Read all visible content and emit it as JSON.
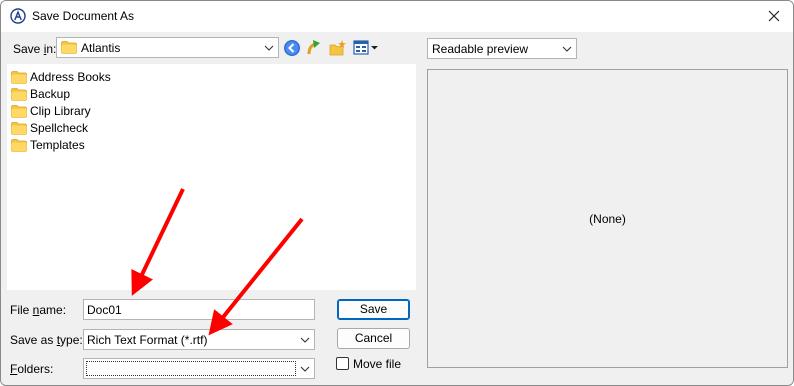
{
  "window": {
    "title": "Save Document As"
  },
  "location": {
    "label_pre": "Save ",
    "label_key": "i",
    "label_post": "n:",
    "current_folder": "Atlantis"
  },
  "folders_list": [
    {
      "name": "Address Books"
    },
    {
      "name": "Backup"
    },
    {
      "name": "Clip Library"
    },
    {
      "name": "Spellcheck"
    },
    {
      "name": "Templates"
    }
  ],
  "preview": {
    "mode": "Readable preview",
    "empty_text": "(None)"
  },
  "form": {
    "file_name_label_pre": "File ",
    "file_name_label_key": "n",
    "file_name_label_post": "ame:",
    "file_name_value": "Doc01",
    "type_label_pre": "Save as ",
    "type_label_key": "t",
    "type_label_post": "ype:",
    "type_value": "Rich Text Format (*.rtf)",
    "folders_label_key": "F",
    "folders_label_post": "olders:",
    "folders_value": ""
  },
  "buttons": {
    "save": "Save",
    "cancel": "Cancel"
  },
  "move_file": {
    "label": "Move file",
    "checked": false
  },
  "colors": {
    "annotation_arrow": "#ff0000",
    "accent": "#0067c0",
    "folder": "#f5c542"
  }
}
